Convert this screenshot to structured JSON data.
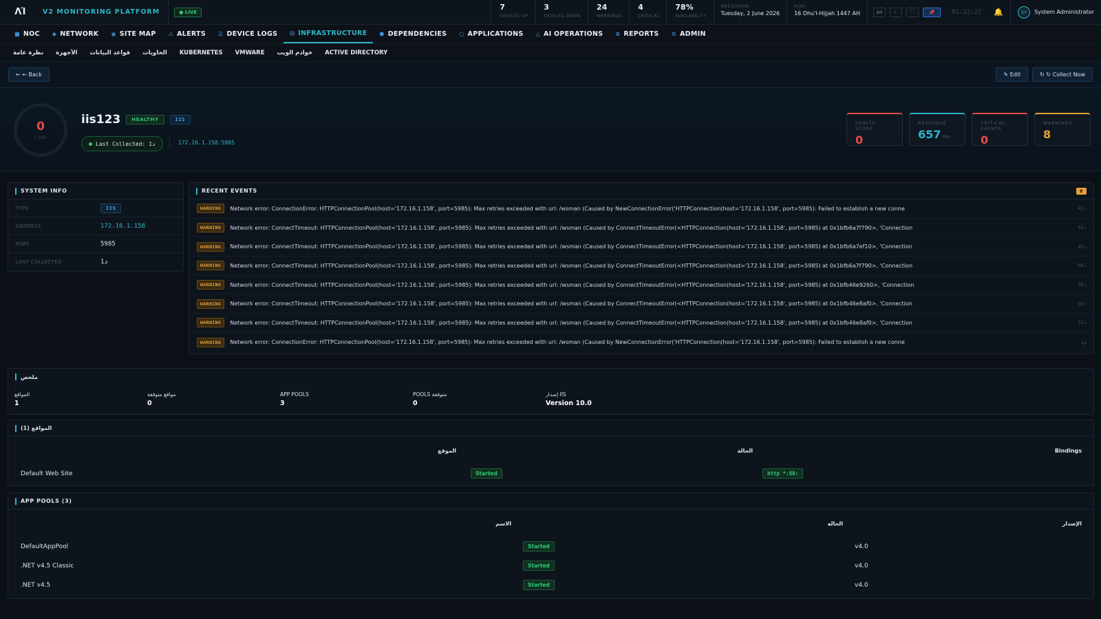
{
  "topbar": {
    "logo": "ΛΊ",
    "brand": "V2 MONITORING PLATFORM",
    "live": "● LIVE",
    "stats": [
      {
        "value": "7",
        "label": "DEVICES UP"
      },
      {
        "value": "3",
        "label": "DEVICES DOWN"
      },
      {
        "value": "24",
        "label": "WARNINGS"
      },
      {
        "value": "4",
        "label": "CRITICAL"
      },
      {
        "value": "78%",
        "label": "AVAILABILITY"
      }
    ],
    "gregorian_label": "GREGORIAN",
    "gregorian_date": "Tuesday, 2 June 2026",
    "hijri_label": "HIJRI",
    "hijri_date": "16 Dhu'l-Hijjah 1447 AH",
    "lang_btn": "AR",
    "theme_icon": "☾",
    "fullscreen_icon": "⛶",
    "pin_icon": "📌",
    "clock": "01:22:22",
    "bell_icon": "🔔",
    "avatar": "SY",
    "user": "System Administrator"
  },
  "nav": [
    {
      "icon": "■",
      "label": "NOC"
    },
    {
      "icon": "◆",
      "label": "NETWORK"
    },
    {
      "icon": "◉",
      "label": "SITE MAP"
    },
    {
      "icon": "⚠",
      "label": "ALERTS"
    },
    {
      "icon": "☰",
      "label": "DEVICE LOGS"
    },
    {
      "icon": "⊟",
      "label": "INFRASTRUCTURE"
    },
    {
      "icon": "⬢",
      "label": "DEPENDENCIES"
    },
    {
      "icon": "○",
      "label": "APPLICATIONS"
    },
    {
      "icon": "△",
      "label": "AI OPERATIONS"
    },
    {
      "icon": "≡",
      "label": "REPORTS"
    },
    {
      "icon": "⚙",
      "label": "ADMIN"
    }
  ],
  "subnav": [
    "نظرة عامة",
    "الأجهزة",
    "قواعد البيانات",
    "الحاويات",
    "KUBERNETES",
    "VMWARE",
    "خوادم الويب",
    "ACTIVE DIRECTORY"
  ],
  "actions": {
    "back": "← ← Back",
    "edit": "✎ Edit",
    "collect": "↻ ↻ Collect Now"
  },
  "device": {
    "score": "0",
    "score_max": "/ 100",
    "name": "iis123",
    "status": "HEALTHY",
    "type_badge": "IIS",
    "last_collected": "Last Collected: 1د",
    "address": "172.16.1.158:5985"
  },
  "kpis": [
    {
      "label": "HEALTH SCORE",
      "value": "0",
      "unit": ""
    },
    {
      "label": "RESPONSE",
      "value": "657",
      "unit": "ms"
    },
    {
      "label": "CRITICAL EVENTS",
      "value": "0",
      "unit": ""
    },
    {
      "label": "WARNINGS",
      "value": "8",
      "unit": ""
    }
  ],
  "system_info": {
    "title": "SYSTEM INFO",
    "rows": [
      {
        "key": "TYPE",
        "value": "IIS"
      },
      {
        "key": "ADDRESS",
        "value": "172.16.1.158"
      },
      {
        "key": "PORT",
        "value": "5985"
      },
      {
        "key": "LAST COLLECTED",
        "value": "1د"
      }
    ]
  },
  "events": {
    "title": "RECENT EVENTS",
    "count": "8",
    "items": [
      {
        "level": "WARNING",
        "message": "Network error: ConnectionError: HTTPConnectionPool(host='172.16.1.158', port=5985): Max retries exceeded with url: /wsman (Caused by NewConnectionError('HTTPConnection(host='172.16.1.158', port=5985): Failed to establish a new conne",
        "age": "41د"
      },
      {
        "level": "WARNING",
        "message": "Network error: ConnectTimeout: HTTPConnectionPool(host='172.16.1.158', port=5985): Max retries exceeded with url: /wsman (Caused by ConnectTimeoutError(<HTTPConnection(host='172.16.1.158', port=5985) at 0x1bfb6a7f790>, 'Connection",
        "age": "43د"
      },
      {
        "level": "WARNING",
        "message": "Network error: ConnectTimeout: HTTPConnectionPool(host='172.16.1.158', port=5985): Max retries exceeded with url: /wsman (Caused by ConnectTimeoutError(<HTTPConnection(host='172.16.1.158', port=5985) at 0x1bfb6a7ef10>, 'Connection",
        "age": "45د"
      },
      {
        "level": "WARNING",
        "message": "Network error: ConnectTimeout: HTTPConnectionPool(host='172.16.1.158', port=5985): Max retries exceeded with url: /wsman (Caused by ConnectTimeoutError(<HTTPConnection(host='172.16.1.158', port=5985) at 0x1bfb6a7f790>, 'Connection",
        "age": "46د"
      },
      {
        "level": "WARNING",
        "message": "Network error: ConnectTimeout: HTTPConnectionPool(host='172.16.1.158', port=5985): Max retries exceeded with url: /wsman (Caused by ConnectTimeoutError(<HTTPConnection(host='172.16.1.158', port=5985) at 0x1bfb46e9260>, 'Connection",
        "age": "48د"
      },
      {
        "level": "WARNING",
        "message": "Network error: ConnectTimeout: HTTPConnectionPool(host='172.16.1.158', port=5985): Max retries exceeded with url: /wsman (Caused by ConnectTimeoutError(<HTTPConnection(host='172.16.1.158', port=5985) at 0x1bfb46e8af0>, 'Connection",
        "age": "50د"
      },
      {
        "level": "WARNING",
        "message": "Network error: ConnectTimeout: HTTPConnectionPool(host='172.16.1.158', port=5985): Max retries exceeded with url: /wsman (Caused by ConnectTimeoutError(<HTTPConnection(host='172.16.1.158', port=5985) at 0x1bfb46e8af0>, 'Connection",
        "age": "52د"
      },
      {
        "level": "WARNING",
        "message": "Network error: ConnectionError: HTTPConnectionPool(host='172.16.1.158', port=5985): Max retries exceeded with url: /wsman (Caused by NewConnectionError('HTTPConnection(host='172.16.1.158', port=5985): Failed to establish a new conne",
        "age": "1س"
      }
    ]
  },
  "summary": {
    "title": "ملخص",
    "cells": [
      {
        "key": "المواقع",
        "value": "1"
      },
      {
        "key": "مواقع متوقفة",
        "value": "0"
      },
      {
        "key": "APP POOLS",
        "value": "3"
      },
      {
        "key": "POOLS متوقفة",
        "value": "0"
      },
      {
        "key": "إصدار IIS",
        "value": "Version 10.0"
      }
    ]
  },
  "sites": {
    "title": "المواقع (1)",
    "headers": [
      "الموقع",
      "الحالة",
      "Bindings"
    ],
    "rows": [
      {
        "name": "Default Web Site",
        "status": "Started",
        "binding": "http *:80:"
      }
    ]
  },
  "pools": {
    "title": "APP POOLS (3)",
    "headers": [
      "الاسم",
      "الحالة",
      "الإصدار"
    ],
    "rows": [
      {
        "name": "DefaultAppPool",
        "status": "Started",
        "version": "v4.0"
      },
      {
        "name": ".NET v4.5 Classic",
        "status": "Started",
        "version": "v4.0"
      },
      {
        "name": ".NET v4.5",
        "status": "Started",
        "version": "v4.0"
      }
    ]
  }
}
